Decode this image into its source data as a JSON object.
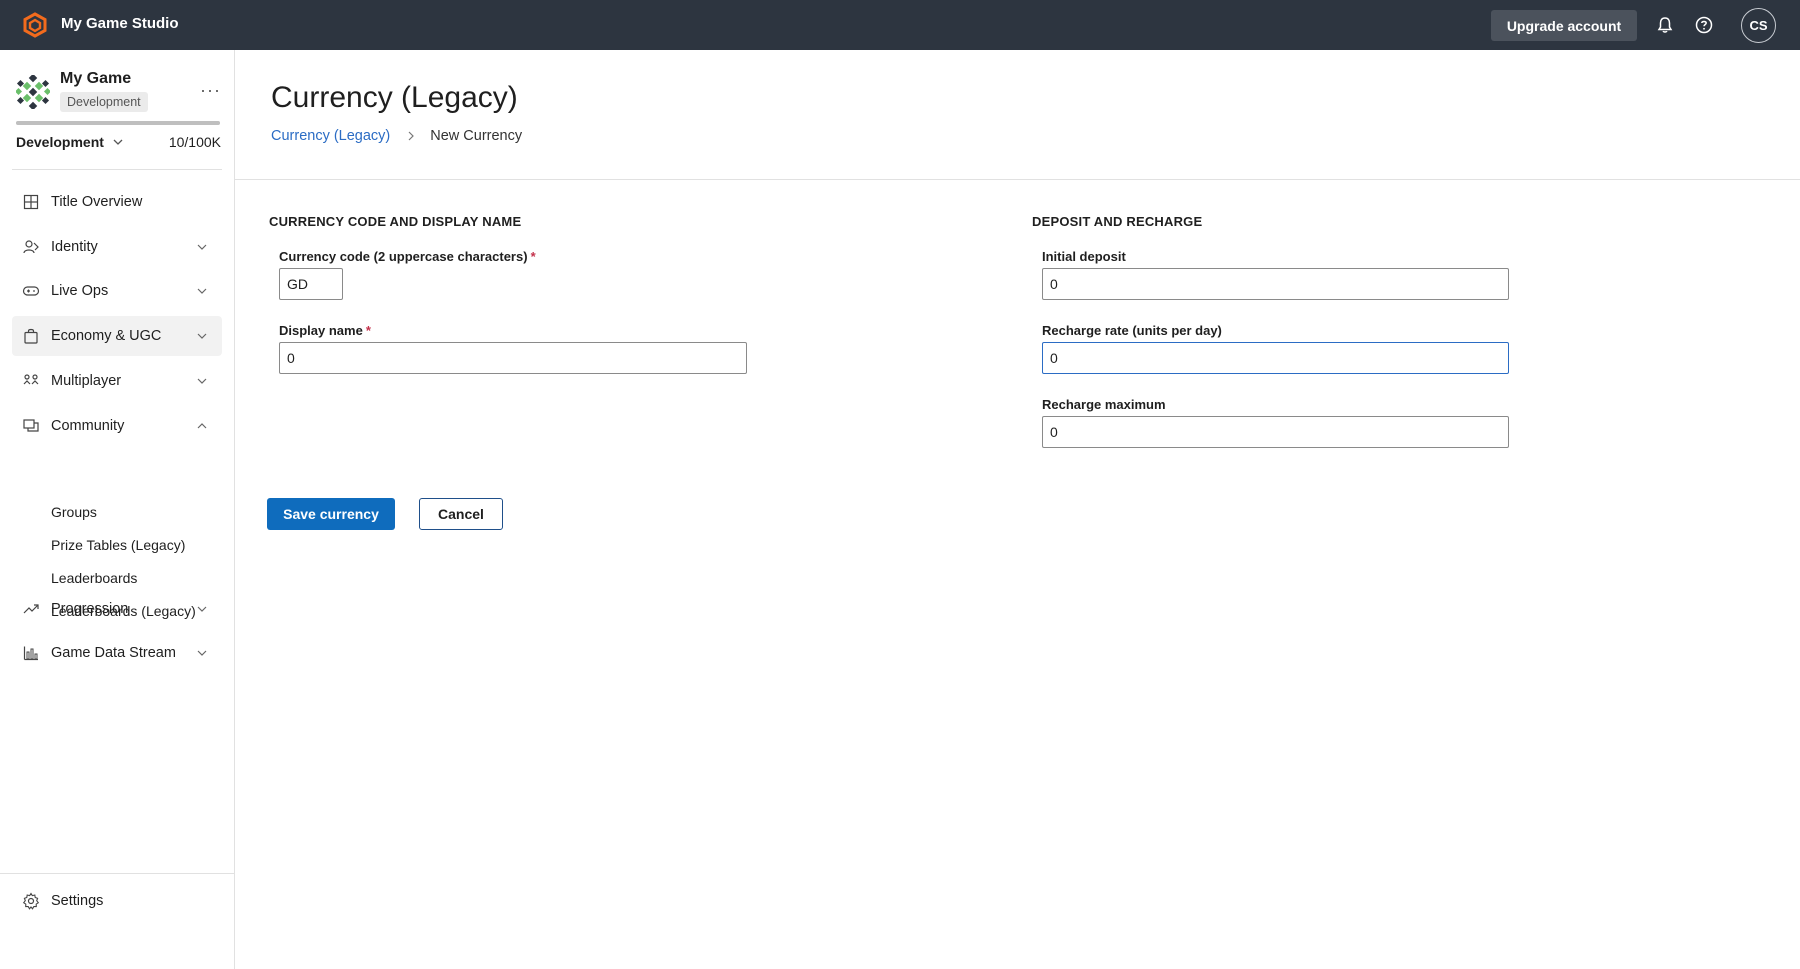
{
  "topbar": {
    "studio_name": "My Game Studio",
    "upgrade_label": "Upgrade account",
    "user_initials": "CS",
    "icons": [
      "studio-logo-icon",
      "bell-icon",
      "help-icon"
    ],
    "bg_color": "#2d3540"
  },
  "sidebar": {
    "game_name": "My Game",
    "env_badge": "Development",
    "env_select": "Development",
    "usage": "10/100K",
    "usage_fraction": 0.0001,
    "items": [
      {
        "label": "Title Overview",
        "icon": "grid-icon"
      },
      {
        "label": "Identity",
        "icon": "identity-icon"
      },
      {
        "label": "Live Ops",
        "icon": "controller-icon"
      },
      {
        "label": "Economy & UGC",
        "icon": "bag-icon"
      },
      {
        "label": "Multiplayer",
        "icon": "multiplayer-icon"
      },
      {
        "label": "Community",
        "icon": "chat-icon"
      },
      {
        "label": "Progression",
        "icon": "trend-icon"
      },
      {
        "label": "Game Data Stream",
        "icon": "bar-chart-icon"
      }
    ],
    "community_sub": [
      "Groups",
      "Prize Tables (Legacy)",
      "Leaderboards",
      "Leaderboards (Legacy)"
    ],
    "settings_label": "Settings"
  },
  "main": {
    "title": "Currency (Legacy)",
    "breadcrumb": {
      "link": "Currency (Legacy)",
      "current": "New Currency"
    },
    "left_section": {
      "title": "CURRENCY CODE AND DISPLAY NAME",
      "code_label": "Currency code (2 uppercase characters)",
      "code_value": "GD",
      "display_label": "Display name",
      "display_value": "0",
      "required_mark": "*"
    },
    "right_section": {
      "title": "DEPOSIT AND RECHARGE",
      "initial_label": "Initial deposit",
      "initial_value": "0",
      "rate_label": "Recharge rate (units per day)",
      "rate_value": "0",
      "max_label": "Recharge maximum",
      "max_value": "0"
    },
    "save_label": "Save currency",
    "cancel_label": "Cancel"
  },
  "colors": {
    "accent": "#0f6cbd",
    "link": "#2b6cc4",
    "logo": "#f26b1d",
    "required": "#c4314b"
  }
}
